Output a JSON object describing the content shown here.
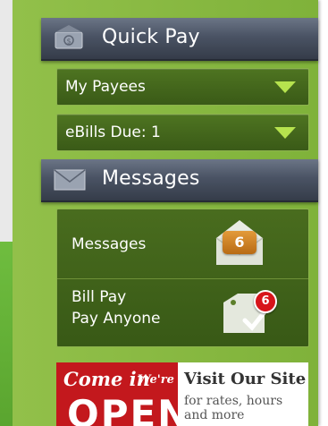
{
  "sidebar": {
    "quick_pay": {
      "title": "Quick Pay",
      "icon": "money-icon",
      "dropdowns": [
        {
          "label": "My Payees"
        },
        {
          "label": "eBills Due: 1"
        }
      ]
    },
    "messages_section": {
      "title": "Messages",
      "icon": "envelope-icon",
      "items": [
        {
          "label": "Messages",
          "badge": "6",
          "icon": "open-envelope-icon"
        },
        {
          "label_line1": "Bill Pay",
          "label_line2": "Pay Anyone",
          "badge": "6",
          "icon": "tag-check-icon"
        }
      ]
    },
    "banner": {
      "sign_line1": "Come in",
      "sign_line2": "We're",
      "sign_big": "OPEN",
      "headline": "Visit Our Site",
      "subtext": "for rates, hours and more"
    }
  },
  "colors": {
    "sidebar_green": "#86b740",
    "header_slate": "#4a5364",
    "dropdown_green": "#446a1c",
    "arrow_green": "#b6e34e",
    "badge_orange": "#cc8224",
    "badge_red": "#d7141a",
    "open_red": "#c3181d"
  }
}
